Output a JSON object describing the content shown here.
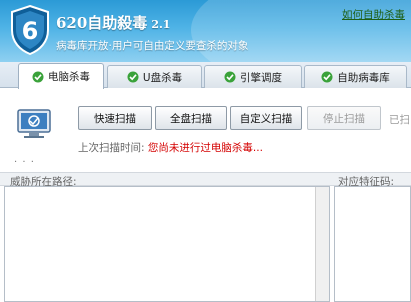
{
  "header": {
    "title": "620自助殺毒",
    "version": "2.1",
    "slogan": "病毒库开放·用户可自由定义要查杀的对象",
    "help_link": "如何自助杀毒"
  },
  "tabs": [
    {
      "label": "电脑杀毒",
      "active": true
    },
    {
      "label": "U盘杀毒",
      "active": false
    },
    {
      "label": "引擎调度",
      "active": false
    },
    {
      "label": "自助病毒库",
      "active": false
    }
  ],
  "scan": {
    "quick_scan": "快速扫描",
    "full_scan": "全盘扫描",
    "custom_scan": "自定义扫描",
    "stop_scan": "停止扫描",
    "stats_partial": "已扫",
    "last_scan_label": "上次扫描时间:",
    "last_scan_value": "您尚未进行过电脑杀毒...",
    "progress_dots": ". . ."
  },
  "results": {
    "path_header": "威胁所在路径:",
    "code_header": "对应特征码:"
  },
  "colors": {
    "header_blue": "#2b9ad6",
    "warning_red": "#d40000",
    "help_link_green": "#1e5f16"
  }
}
